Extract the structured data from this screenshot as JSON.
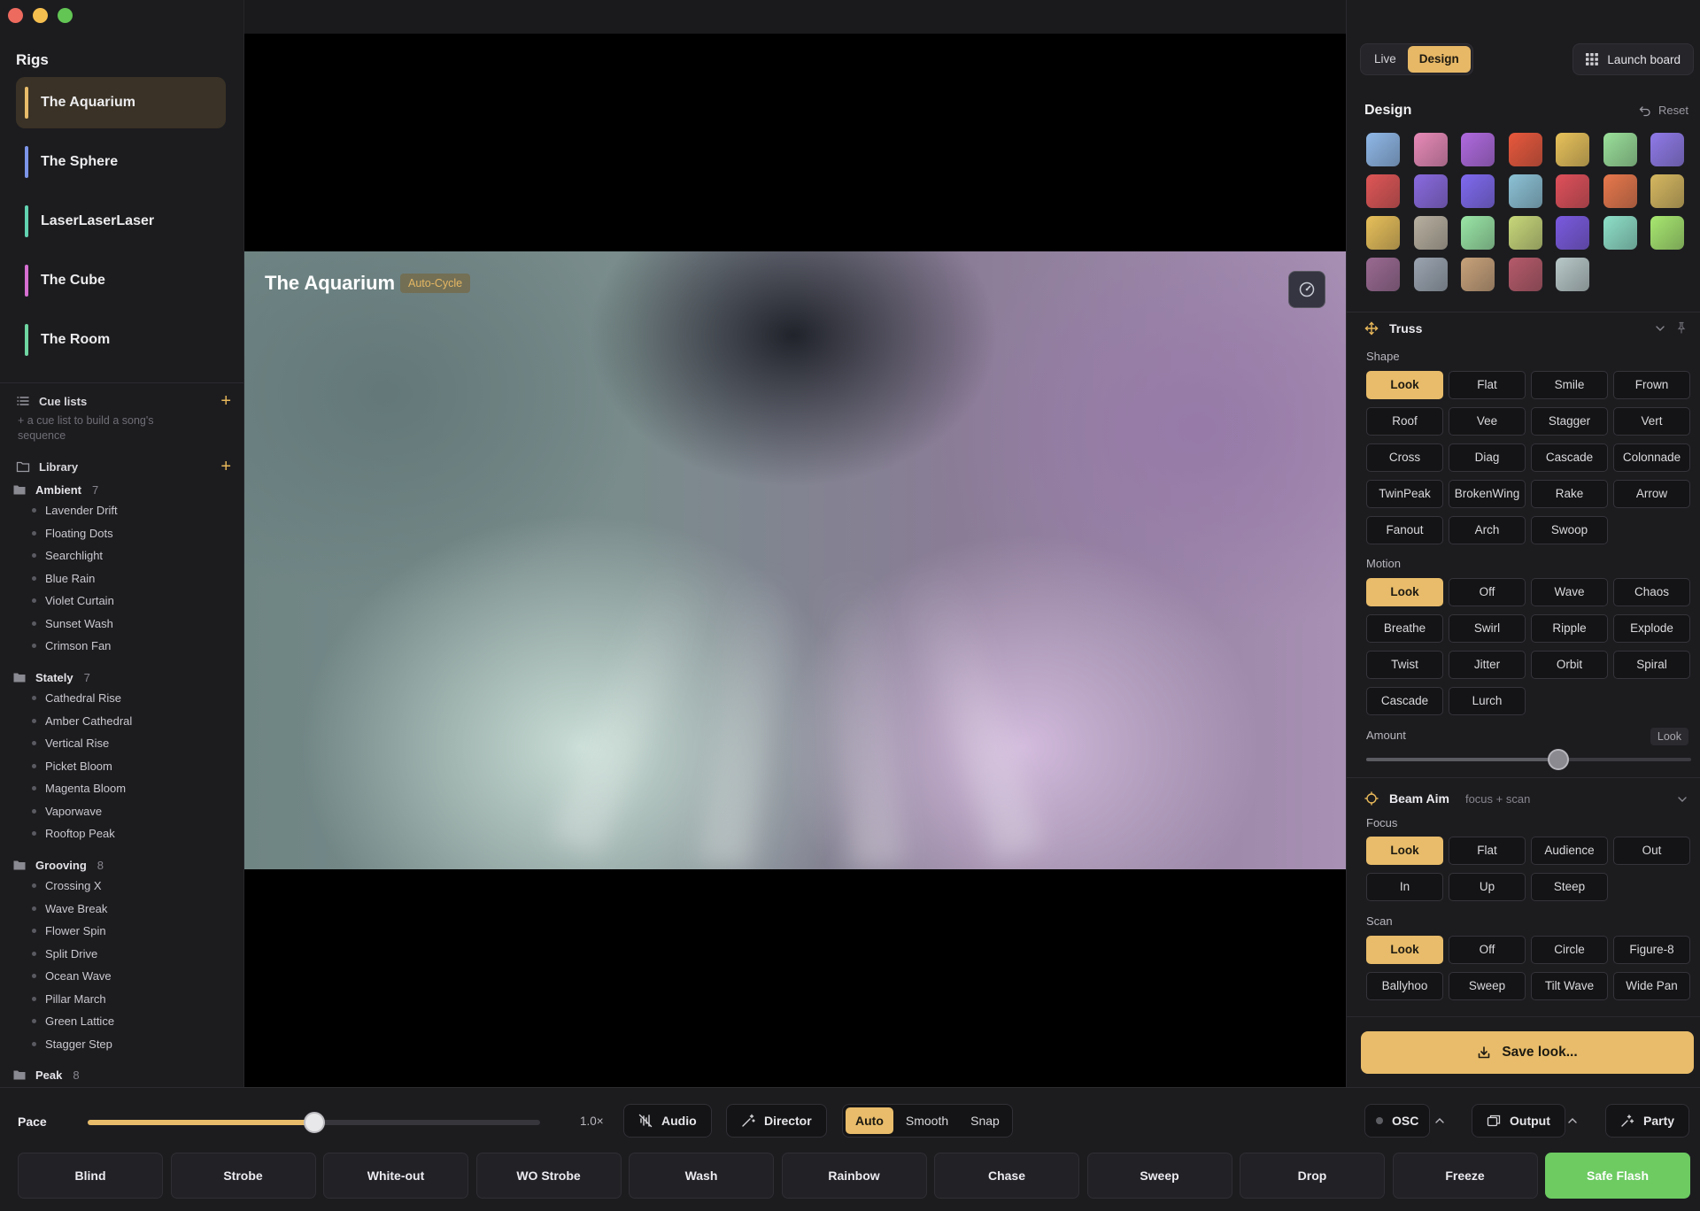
{
  "sidebar": {
    "rigs_title": "Rigs",
    "rigs": [
      {
        "name": "The Aquarium",
        "color": "#e8bc6a",
        "active": true
      },
      {
        "name": "The Sphere",
        "color": "#7c95e8"
      },
      {
        "name": "LaserLaserLaser",
        "color": "#62d3b0"
      },
      {
        "name": "The Cube",
        "color": "#d66fd1"
      },
      {
        "name": "The Room",
        "color": "#6fd6a2"
      }
    ],
    "cue_lists_label": "Cue lists",
    "cue_hint": "+ a cue list to build a song's sequence",
    "library_label": "Library",
    "groups": [
      {
        "name": "Ambient",
        "count": "7",
        "items": [
          "Lavender Drift",
          "Floating Dots",
          "Searchlight",
          "Blue Rain",
          "Violet Curtain",
          "Sunset Wash",
          "Crimson Fan"
        ]
      },
      {
        "name": "Stately",
        "count": "7",
        "items": [
          "Cathedral Rise",
          "Amber Cathedral",
          "Vertical Rise",
          "Picket Bloom",
          "Magenta Bloom",
          "Vaporwave",
          "Rooftop Peak"
        ]
      },
      {
        "name": "Grooving",
        "count": "8",
        "items": [
          "Crossing X",
          "Wave Break",
          "Flower Spin",
          "Split Drive",
          "Ocean Wave",
          "Pillar March",
          "Green Lattice",
          "Stagger Step"
        ]
      },
      {
        "name": "Peak",
        "count": "8",
        "items": []
      }
    ]
  },
  "viewport": {
    "title": "The Aquarium",
    "badge": "Auto-Cycle"
  },
  "right": {
    "tabs": [
      {
        "label": "Live",
        "on": false
      },
      {
        "label": "Design",
        "on": true
      }
    ],
    "launch_label": "Launch board",
    "design_title": "Design",
    "reset_label": "Reset",
    "palettes": [
      [
        "#8fb8e8",
        "#e88ab8",
        "#b06ae0",
        "#e8583c",
        "#e8c25a",
        "#9ae09a",
        "#8f7ae8"
      ],
      [
        "#e05656",
        "#8a6ae0",
        "#7f6af0",
        "#8cc2d6",
        "#e0505a",
        "#e8784c",
        "#d6b860"
      ],
      [
        "#e8c05a",
        "#b8b0a0",
        "#9ae6a6",
        "#c8d87a",
        "#7a5ae0",
        "#8ee0c8",
        "#a8e870"
      ],
      [
        "#9a6a92",
        "#9aa4b0",
        "#c8a27a",
        "#b65a6a",
        "#b8c8c8"
      ]
    ],
    "truss": {
      "title": "Truss",
      "shape_label": "Shape",
      "shapes": [
        "Look",
        "Flat",
        "Smile",
        "Frown",
        "Roof",
        "Vee",
        "Stagger",
        "Vert",
        "Cross",
        "Diag",
        "Cascade",
        "Colonnade",
        "TwinPeak",
        "BrokenWing",
        "Rake",
        "Arrow",
        "Fanout",
        "Arch",
        "Swoop"
      ],
      "motion_label": "Motion",
      "motions": [
        "Look",
        "Off",
        "Wave",
        "Chaos",
        "Breathe",
        "Swirl",
        "Ripple",
        "Explode",
        "Twist",
        "Jitter",
        "Orbit",
        "Spiral",
        "Cascade",
        "Lurch"
      ],
      "amount_label": "Amount",
      "amount_tag": "Look",
      "amount_value": 0.59
    },
    "beam": {
      "title": "Beam Aim",
      "subtitle": "focus + scan",
      "focus_label": "Focus",
      "focus": [
        "Look",
        "Flat",
        "Audience",
        "Out",
        "In",
        "Up",
        "Steep"
      ],
      "scan_label": "Scan",
      "scan": [
        "Look",
        "Off",
        "Circle",
        "Figure-8",
        "Ballyhoo",
        "Sweep",
        "Tilt Wave",
        "Wide Pan"
      ]
    },
    "save_label": "Save look..."
  },
  "bottom": {
    "pace_label": "Pace",
    "pace_value": "1.0×",
    "pace_fraction": 0.5,
    "audio_label": "Audio",
    "director_label": "Director",
    "modes": [
      {
        "label": "Auto",
        "on": true
      },
      {
        "label": "Smooth",
        "on": false
      },
      {
        "label": "Snap",
        "on": false
      }
    ],
    "osc_label": "OSC",
    "output_label": "Output",
    "party_label": "Party",
    "actions": [
      "Blind",
      "Strobe",
      "White-out",
      "WO Strobe",
      "Wash",
      "Rainbow",
      "Chase",
      "Sweep",
      "Drop",
      "Freeze",
      "Safe Flash"
    ]
  }
}
